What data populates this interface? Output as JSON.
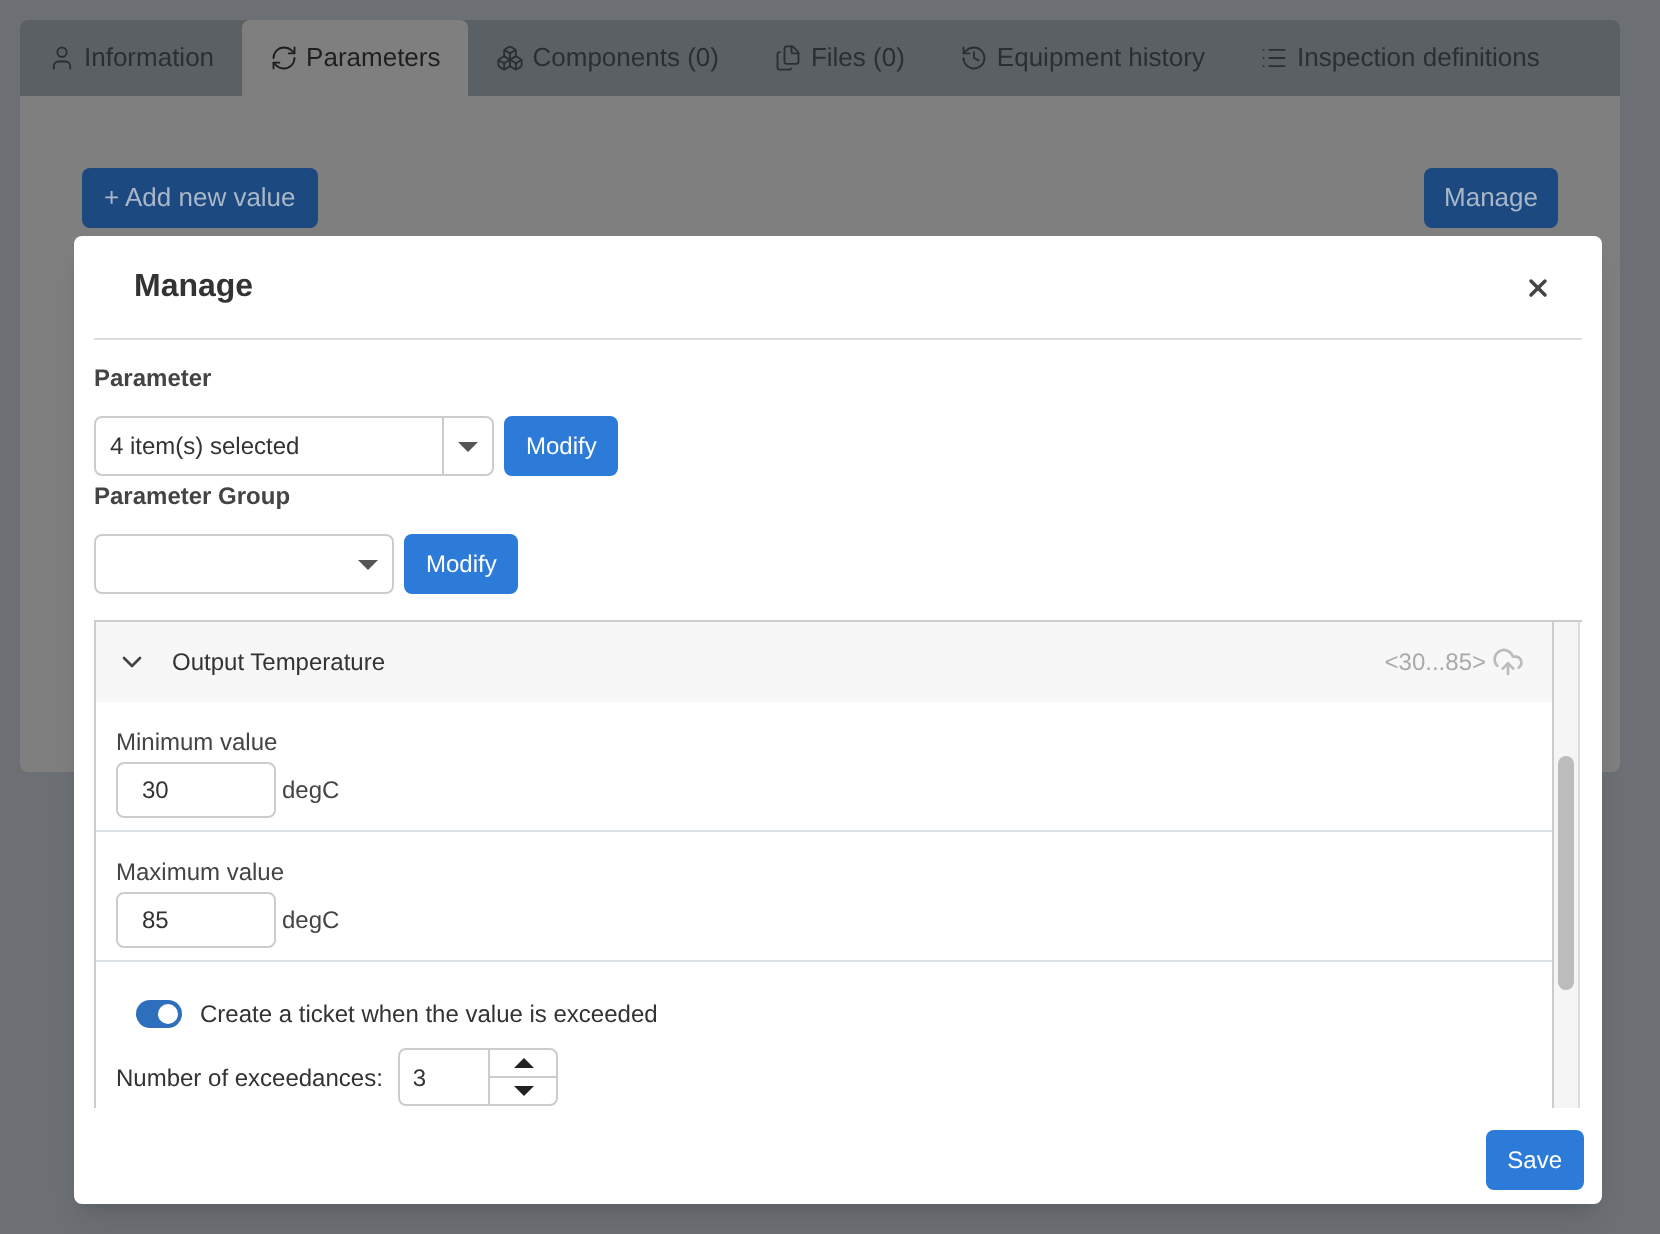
{
  "tabs": [
    {
      "label": "Information",
      "selected": false
    },
    {
      "label": "Parameters",
      "selected": true
    },
    {
      "label": "Components (0)",
      "selected": false
    },
    {
      "label": "Files (0)",
      "selected": false
    },
    {
      "label": "Equipment history",
      "selected": false
    },
    {
      "label": "Inspection definitions",
      "selected": false
    }
  ],
  "toolbar": {
    "add_button": "+ Add new value",
    "manage_button": "Manage"
  },
  "dialog": {
    "title": "Manage",
    "parameter": {
      "label": "Parameter",
      "value": "4 item(s) selected",
      "button": "Modify"
    },
    "parameter_group": {
      "label": "Parameter Group",
      "button": "Modify"
    },
    "section": {
      "title": "Output Temperature",
      "expanded": true,
      "range": "<30...85>",
      "fields": [
        {
          "label": "Minimum value",
          "value": "30",
          "unit": "degC"
        },
        {
          "label": "Maximum value",
          "value": "85",
          "unit": "degC"
        }
      ],
      "ticket_toggle": {
        "label": "Create a ticket when the value is exceeded",
        "on": true
      },
      "exceedances": {
        "label": "Number of exceedances:",
        "value": "3"
      }
    },
    "save_button": "Save"
  }
}
